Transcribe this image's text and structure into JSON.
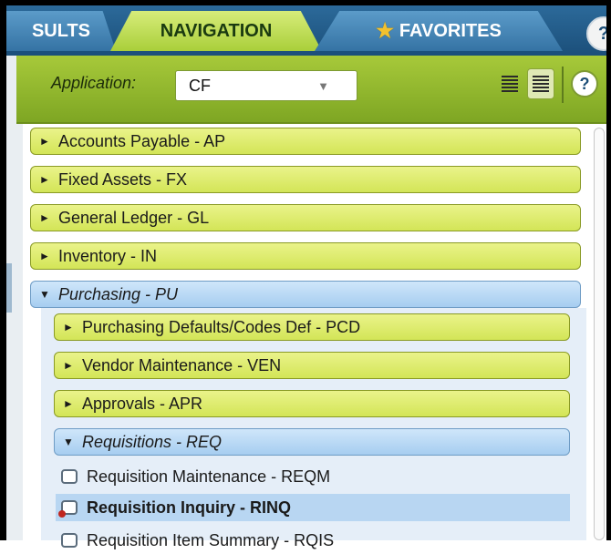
{
  "tabs": {
    "results": "SULTS",
    "navigation": "NAVIGATION",
    "favorites": "FAVORITES",
    "help": "?"
  },
  "app_bar": {
    "label": "Application:",
    "selected_value": "CF",
    "help": "?"
  },
  "icons": {
    "favorites": "star-icon",
    "collapse_all": "align-lines-icon",
    "expand_all": "align-lines-icon",
    "document": "document-icon"
  },
  "tree": {
    "modules": [
      {
        "label": "Accounts Payable - AP",
        "expanded": false
      },
      {
        "label": "Fixed Assets - FX",
        "expanded": false
      },
      {
        "label": "General Ledger - GL",
        "expanded": false
      },
      {
        "label": "Inventory - IN",
        "expanded": false
      },
      {
        "label": "Purchasing - PU",
        "expanded": true
      }
    ],
    "submodules": [
      {
        "label": "Purchasing Defaults/Codes Def - PCD",
        "expanded": false
      },
      {
        "label": "Vendor Maintenance - VEN",
        "expanded": false
      },
      {
        "label": "Approvals - APR",
        "expanded": false
      },
      {
        "label": "Requisitions - REQ",
        "expanded": true
      }
    ],
    "leaves": [
      {
        "label": "Requisition Maintenance - REQM",
        "selected": false
      },
      {
        "label": "Requisition Inquiry - RINQ",
        "selected": true
      },
      {
        "label": "Requisition Item Summary - RQIS",
        "selected": false
      }
    ]
  },
  "colors": {
    "tab_active": "#b9dc4e",
    "tab_inactive": "#3f7fb0",
    "module_node": "#dde96f",
    "expanded_node": "#b8d8f4",
    "selected_row": "#b8d6f2"
  }
}
